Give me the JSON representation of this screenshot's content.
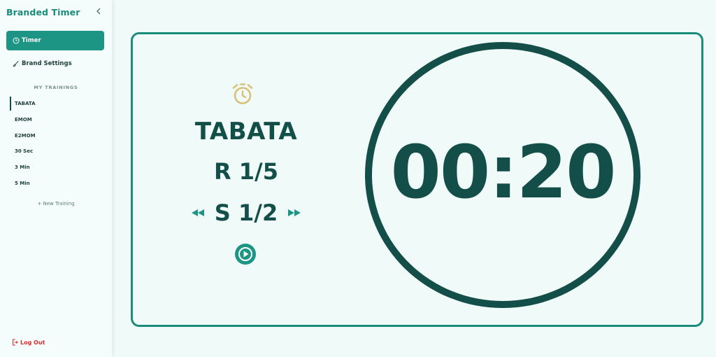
{
  "app": {
    "title": "Branded Timer"
  },
  "nav": {
    "timer_label": "Timer",
    "brand_settings_label": "Brand Settings"
  },
  "trainings": {
    "section_title": "MY TRAININGS",
    "items": [
      "TABATA",
      "EMOM",
      "E2MOM",
      "30 Sec",
      "3 Min",
      "5 Min"
    ],
    "active": "TABATA",
    "new_label": "+ New Training"
  },
  "logout_label": "Log Out",
  "timer": {
    "training_name": "TABATA",
    "round": "R 1/5",
    "set": "S 1/2",
    "time": "00:20"
  },
  "icons": {
    "collapse": "chevron-left-icon",
    "timer_nav": "clock-icon",
    "brand_nav": "brush-icon",
    "alarm": "alarm-clock-icon",
    "prev": "rewind-icon",
    "next": "fast-forward-icon",
    "play": "play-icon",
    "logout": "logout-icon"
  },
  "colors": {
    "accent": "#1d9584",
    "dark": "#134e48",
    "alarm": "#d9c07a",
    "logout": "#d92c2c",
    "background": "#f0fbf9"
  }
}
